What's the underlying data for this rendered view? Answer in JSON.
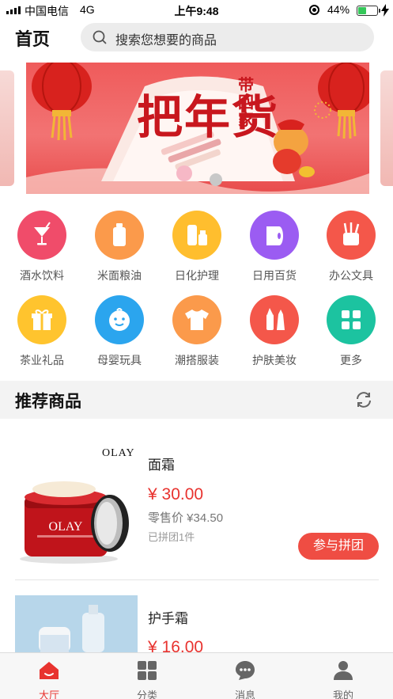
{
  "status_bar": {
    "carrier": "中国电信",
    "network": "4G",
    "time": "上午9:48",
    "battery": "44%",
    "battery_level": 0.44
  },
  "header": {
    "title": "首页",
    "search_placeholder": "搜索您想要的商品"
  },
  "banner": {
    "slogan": "把年货",
    "slogan_side": "带回家"
  },
  "categories": [
    {
      "label": "酒水饮料",
      "icon": "cocktail-icon",
      "color": "#f04c6a"
    },
    {
      "label": "米面粮油",
      "icon": "bottle-icon",
      "color": "#fb9a4b"
    },
    {
      "label": "日化护理",
      "icon": "toiletries-icon",
      "color": "#ffbe2e"
    },
    {
      "label": "日用百货",
      "icon": "tissue-roll-icon",
      "color": "#9b5cf2"
    },
    {
      "label": "办公文具",
      "icon": "pen-holder-icon",
      "color": "#f4574a"
    },
    {
      "label": "茶业礼品",
      "icon": "gift-icon",
      "color": "#ffc42e"
    },
    {
      "label": "母婴玩具",
      "icon": "baby-face-icon",
      "color": "#2ba5ee"
    },
    {
      "label": "潮搭服装",
      "icon": "tshirt-icon",
      "color": "#fb9a4b"
    },
    {
      "label": "护肤美妆",
      "icon": "makeup-icon",
      "color": "#f4574a"
    },
    {
      "label": "更多",
      "icon": "grid-icon",
      "color": "#1cc3a0"
    }
  ],
  "section": {
    "title": "推荐商品"
  },
  "products": [
    {
      "brand": "OLAY",
      "name": "面霜",
      "price": "¥ 30.00",
      "retail": "零售价 ¥34.50",
      "grouped": "已拼团1件",
      "action": "参与拼团"
    },
    {
      "name": "护手霜",
      "price": "¥ 16.00"
    }
  ],
  "tabs": [
    {
      "label": "大厅",
      "icon": "home-icon",
      "active": true
    },
    {
      "label": "分类",
      "icon": "category-grid-icon",
      "active": false
    },
    {
      "label": "消息",
      "icon": "message-icon",
      "active": false
    },
    {
      "label": "我的",
      "icon": "user-icon",
      "active": false
    }
  ],
  "colors": {
    "accent": "#e8332f",
    "button": "#ef4d43",
    "section_bg": "#f3f3f3"
  }
}
